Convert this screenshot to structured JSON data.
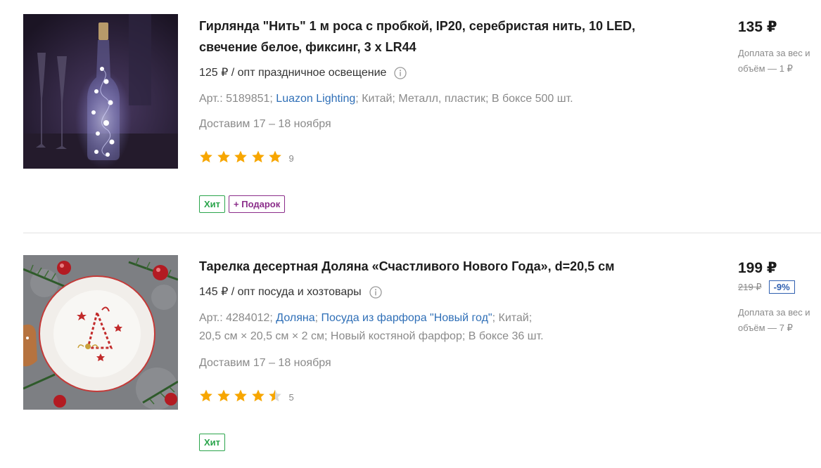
{
  "products": [
    {
      "title": "Гирлянда \"Нить\" 1 м роса с пробкой, IP20, серебристая нить, 10 LED, свечение белое, фиксинг, 3 х LR44",
      "wholesale": "125 ₽ / опт праздничное освещение",
      "meta": {
        "art": "Арт.: 5189851;",
        "brand": "Luazon Lighting",
        "rest": [
          "Китай;",
          "Металл, пластик;",
          "В боксе 500 шт."
        ]
      },
      "delivery": "Доставим 17 – 18 ноября",
      "rating_count": "9",
      "rating": 5,
      "badges": [
        "Хит",
        "+ Подарок"
      ],
      "price": "135 ₽",
      "extra": "Доплата за вес и объём — 1 ₽"
    },
    {
      "title": "Тарелка десертная Доляна «Счастливого Нового Года», d=20,5 см",
      "wholesale": "145 ₽ / опт посуда и хозтовары",
      "meta": {
        "art": "Арт.: 4284012;",
        "brand": "Доляна",
        "collection": "Посуда из фарфора \"Новый год\"",
        "rest": [
          "Китай;",
          "20,5 см × 20,5 см × 2 см;",
          "Новый костяной фарфор;",
          "В боксе 36 шт."
        ]
      },
      "delivery": "Доставим 17 – 18 ноября",
      "rating_count": "5",
      "rating": 4.5,
      "badges": [
        "Хит"
      ],
      "price": "199 ₽",
      "old_price": "219 ₽",
      "discount": "-9%",
      "extra": "Доплата за вес и объём — 7 ₽"
    }
  ],
  "colors": {
    "star": "#f7a600",
    "link": "#2f6fb7",
    "hit": "#2ba54c",
    "gift": "#8b2d8a",
    "discount": "#2f5fb0"
  }
}
